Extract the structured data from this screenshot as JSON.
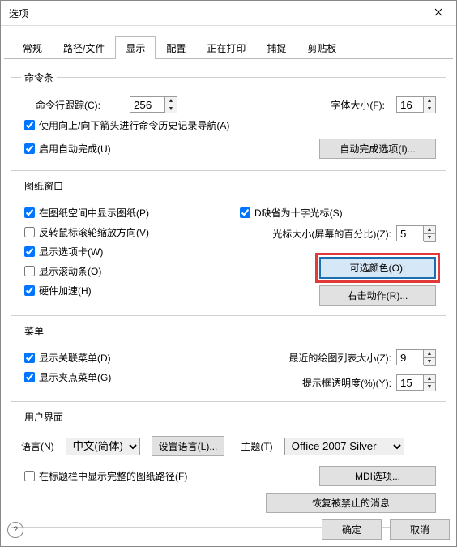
{
  "title": "选项",
  "tabs": [
    "常规",
    "路径/文件",
    "显示",
    "配置",
    "正在打印",
    "捕捉",
    "剪贴板"
  ],
  "activeTab": 2,
  "group_cmdbar": {
    "legend": "命令条",
    "cmdline_label": "命令行跟踪(C):",
    "cmdline_value": "256",
    "font_label": "字体大小(F):",
    "font_value": "16",
    "use_arrows": "使用向上/向下箭头进行命令历史记录导航(A)",
    "autocomplete": "启用自动完成(U)",
    "autocomplete_btn": "自动完成选项(I)..."
  },
  "group_drawwin": {
    "legend": "图纸窗口",
    "show_sheets": "在图纸空间中显示图纸(P)",
    "reverse_wheel": "反转鼠标滚轮缩放方向(V)",
    "show_tabs": "显示选项卡(W)",
    "show_scroll": "显示滚动条(O)",
    "hwaccel": "硬件加速(H)",
    "crosshair": "D缺省为十字光标(S)",
    "cursor_label": "光标大小(屏幕的百分比)(Z):",
    "cursor_value": "5",
    "colors_btn": "可选颜色(O):",
    "rclick_btn": "右击动作(R)..."
  },
  "group_menu": {
    "legend": "菜单",
    "show_context": "显示关联菜单(D)",
    "show_grip": "显示夹点菜单(G)",
    "recent_label": "最近的绘图列表大小(Z):",
    "recent_value": "9",
    "tip_label": "提示框透明度(%)(Y):",
    "tip_value": "15"
  },
  "group_ui": {
    "legend": "用户界面",
    "lang_label": "语言(N)",
    "lang_value": "中文(简体)",
    "setlang_btn": "设置语言(L)...",
    "theme_label": "主题(T)",
    "theme_value": "Office 2007 Silver",
    "fullpath": "在标题栏中显示完整的图纸路径(F)",
    "mdi_btn": "MDI选项...",
    "restore_btn": "恢复被禁止的消息"
  },
  "footer": {
    "ok": "确定",
    "cancel": "取消",
    "help": "?"
  },
  "checked": {
    "use_arrows": true,
    "autocomplete": true,
    "show_sheets": true,
    "reverse_wheel": false,
    "show_tabs": true,
    "show_scroll": false,
    "hwaccel": true,
    "crosshair": true,
    "show_context": true,
    "show_grip": true,
    "fullpath": false
  }
}
